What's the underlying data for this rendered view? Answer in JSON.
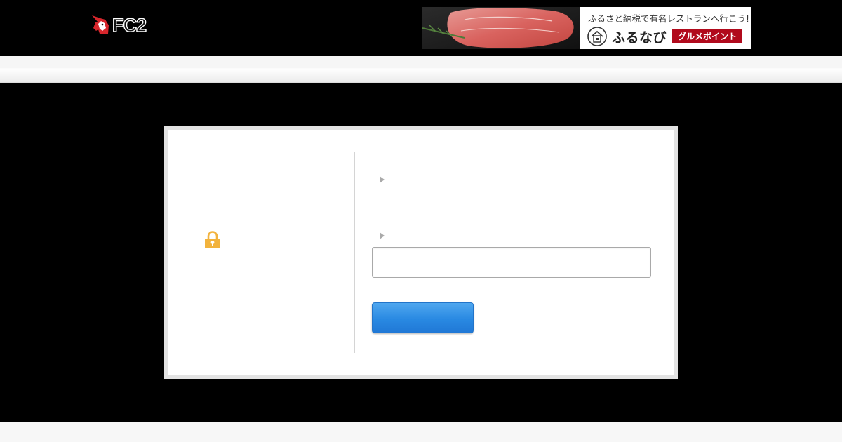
{
  "header": {
    "logo": {
      "text": "FC2"
    },
    "ad": {
      "headline": "ふるさと納税で有名レストランへ行こう!",
      "brand": "ふるなび",
      "badge": "グルメポイント"
    }
  },
  "login": {
    "password_input": {
      "value": "",
      "placeholder": ""
    },
    "submit_label": ""
  },
  "colors": {
    "page_background": "#000000",
    "panel_background": "#ffffff",
    "panel_border": "#e3e3e3",
    "button_blue": "#2989e2",
    "lock_yellow": "#f2b33d",
    "ad_badge_red": "#b10a1c"
  },
  "icons": [
    "unicorn-logo-icon",
    "lock-icon",
    "triangle-arrow-icon",
    "furunavi-house-icon"
  ]
}
